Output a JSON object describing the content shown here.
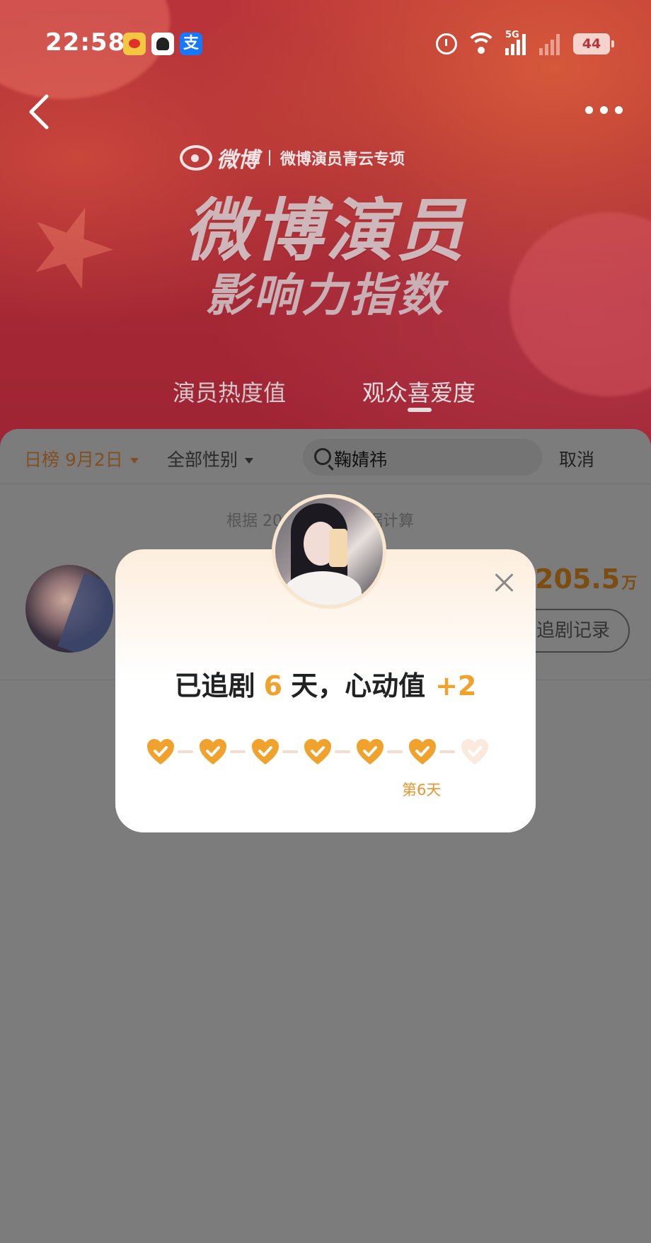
{
  "status_bar": {
    "time": "22:58",
    "battery": "44",
    "signal_label": "5G",
    "app_icons": [
      "weibo-icon",
      "github-icon",
      "alipay-icon"
    ],
    "alipay_glyph": "支"
  },
  "header": {
    "brand_name": "微博",
    "brand_sub": "微博演员青云专项",
    "title_line1": "微博演员",
    "title_line2": "影响力指数",
    "tabs": [
      "演员热度值",
      "观众喜爱度"
    ],
    "active_tab": 1
  },
  "filters": {
    "date": "日榜 9月2日",
    "gender": "全部性别",
    "search_value": "鞠婧祎",
    "cancel": "取消"
  },
  "list": {
    "calc_note": "根据 20",
    "calc_note_tail": "据计算",
    "score_value": "205.5",
    "score_unit": "万",
    "record_button": "追剧记录"
  },
  "popup": {
    "text_prefix": "已追剧",
    "days": "6",
    "text_mid": "天，心动值",
    "plus": "+2",
    "day_label": "第6天",
    "checked_days": 6,
    "total_days": 7
  },
  "colors": {
    "accent_orange": "#f0a22d",
    "header_red": "#a82a34",
    "overlay_gray": "#7c7c7c"
  }
}
